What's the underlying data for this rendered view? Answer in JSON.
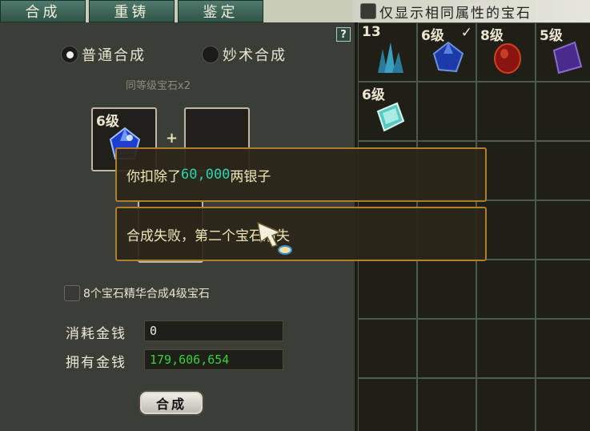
{
  "tabs": [
    {
      "label": "合成"
    },
    {
      "label": "重铸"
    },
    {
      "label": "鉴定"
    }
  ],
  "filter": {
    "label": "仅显示相同属性的宝石",
    "checked": false
  },
  "help": {
    "label": "?"
  },
  "mode": {
    "options": [
      {
        "label": "普通合成",
        "selected": true
      },
      {
        "label": "妙术合成",
        "selected": false
      }
    ],
    "hint": "同等级宝石x2"
  },
  "slots": [
    {
      "level": "6级",
      "gem": "blue-gem-icon"
    },
    {
      "level": "",
      "gem": ""
    }
  ],
  "plus": "+",
  "essence": {
    "label": "8个宝石精华合成4级宝石",
    "checked": false
  },
  "money": {
    "cost_label": "消耗金钱",
    "cost_value": "0",
    "owned_label": "拥有金钱",
    "owned_value": "179,606,654"
  },
  "synth_button": "合成",
  "inventory": [
    {
      "level": "13",
      "gem": "crystal-cluster-icon",
      "checked": false
    },
    {
      "level": "6级",
      "gem": "blue-gem-icon",
      "checked": true
    },
    {
      "level": "8级",
      "gem": "red-gem-icon",
      "checked": false
    },
    {
      "level": "5级",
      "gem": "purple-gem-icon",
      "checked": false
    },
    {
      "level": "6级",
      "gem": "cyan-gem-icon",
      "checked": false
    }
  ],
  "messages": [
    {
      "prefix": "你扣除了",
      "amount": "60,000",
      "suffix": "两银子"
    },
    {
      "text": "合成失败，第二个宝石消失"
    }
  ],
  "colors": {
    "accent_gold": "#b07c2e",
    "money_green": "#38d038",
    "notice_green": "#2ad4b0"
  }
}
